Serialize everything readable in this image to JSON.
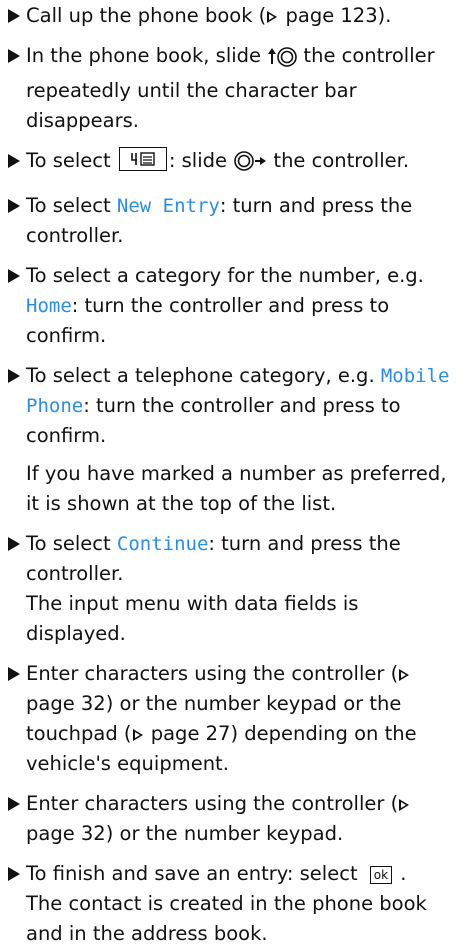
{
  "steps": [
    {
      "t1": "Call up the phone book (",
      "ref": "page 123",
      "t2": ")."
    },
    {
      "t1": "In the phone book, slide ",
      "t2": " the controller repeatedly until the character bar disappears.",
      "icon": "controller-slide-up-icon"
    },
    {
      "t1": "To select ",
      "t2": ": slide ",
      "t3": " the controller.",
      "icon_menu": "phonebook-menu-icon",
      "icon": "controller-slide-right-icon"
    },
    {
      "t1": "To select ",
      "hl": "New Entry",
      "t2": ": turn and press the controller."
    },
    {
      "t1": "To select a category for the number, e.g. ",
      "hl": "Home",
      "t2": ": turn the controller and press to confirm."
    },
    {
      "t1": "To select a telephone category, e.g. ",
      "hl": "Mobile Phone",
      "t2": ": turn the controller and press to confirm."
    },
    {
      "para": "If you have marked a number as preferred, it is shown at the top of the list."
    },
    {
      "t1": "To select ",
      "hl": "Continue",
      "t2": ": turn and press the controller.",
      "sub": "The input menu with data fields is displayed."
    },
    {
      "t1": "Enter characters using the controller (",
      "ref": "page 32",
      "t2": ") or the number keypad or the touchpad (",
      "ref2": "page 27",
      "t3": ") depending on the vehicle's equipment."
    },
    {
      "t1": "Enter characters using the controller (",
      "ref": "page 32",
      "t2": ") or the number keypad."
    },
    {
      "t1": "To finish and save an entry: select ",
      "ok": "ok",
      "t2": " .",
      "sub": "The contact is created in the phone book and in the address book."
    }
  ],
  "colors": {
    "highlight": "#2b8ee0",
    "text": "#111111"
  }
}
